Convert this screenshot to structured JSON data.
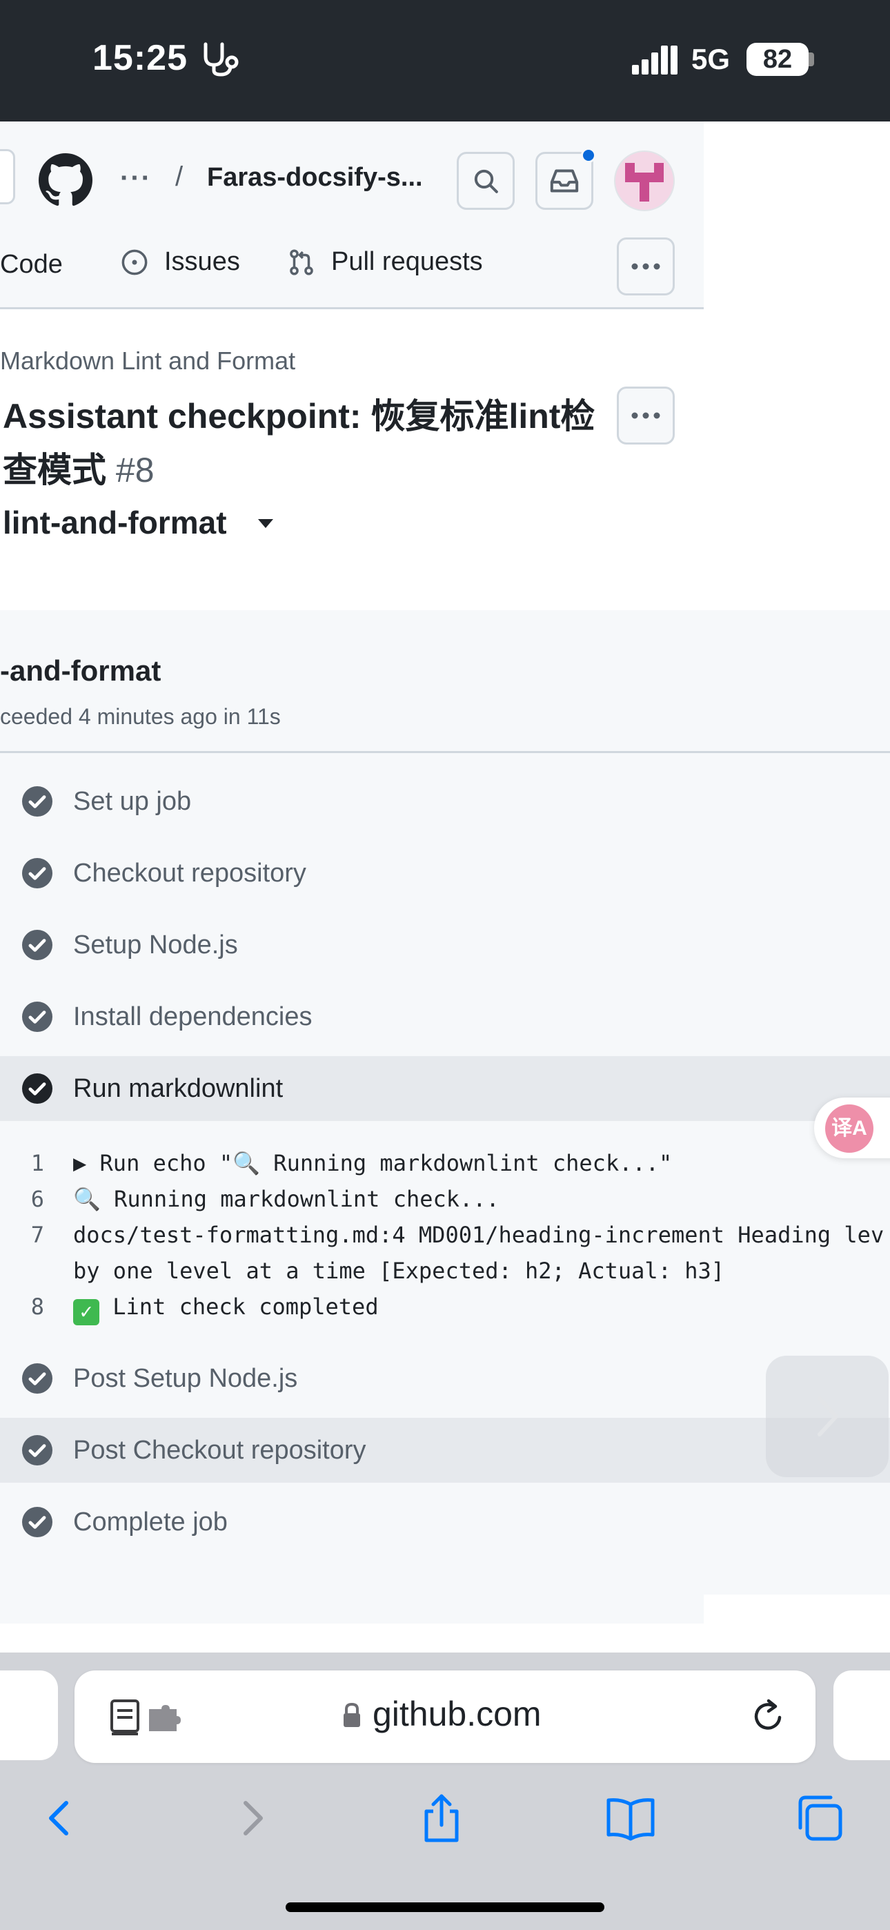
{
  "status_bar": {
    "time": "15:25",
    "network": "5G",
    "battery": "82"
  },
  "header": {
    "breadcrumb_ellipsis": "···",
    "breadcrumb_sep": "/",
    "repo": "Faras-docsify-s...",
    "nav": {
      "code": "Code",
      "issues": "Issues",
      "pull_requests": "Pull requests"
    }
  },
  "run": {
    "workflow_name": "Markdown Lint and Format",
    "title": "Assistant checkpoint: 恢复标准lint检查模式",
    "number": "#8",
    "job_select": "lint-and-format"
  },
  "job": {
    "title": "-and-format",
    "meta": "ceeded 4 minutes ago in 11s",
    "steps_before": [
      "Set up job",
      "Checkout repository",
      "Setup Node.js",
      "Install dependencies"
    ],
    "active_step": "Run markdownlint",
    "log": [
      {
        "num": "1",
        "text": "▶ Run echo \"🔍 Running markdownlint check...\""
      },
      {
        "num": "6",
        "text": "🔍 Running markdownlint check..."
      },
      {
        "num": "7",
        "text": "docs/test-formatting.md:4 MD001/heading-increment Heading lev"
      },
      {
        "num": "",
        "text": "by one level at a time [Expected: h2; Actual: h3]"
      },
      {
        "num": "8",
        "text": "Lint check completed"
      }
    ],
    "steps_after": [
      "Post Setup Node.js",
      "Post Checkout repository",
      "Complete job"
    ]
  },
  "browser": {
    "url": "github.com",
    "translate_glyph": "译A"
  },
  "colors": {
    "header_bg": "#24292f",
    "success": "#3fb950",
    "step_icon": "#57606a",
    "link_blue": "#0969da",
    "safari_blue": "#007aff"
  }
}
